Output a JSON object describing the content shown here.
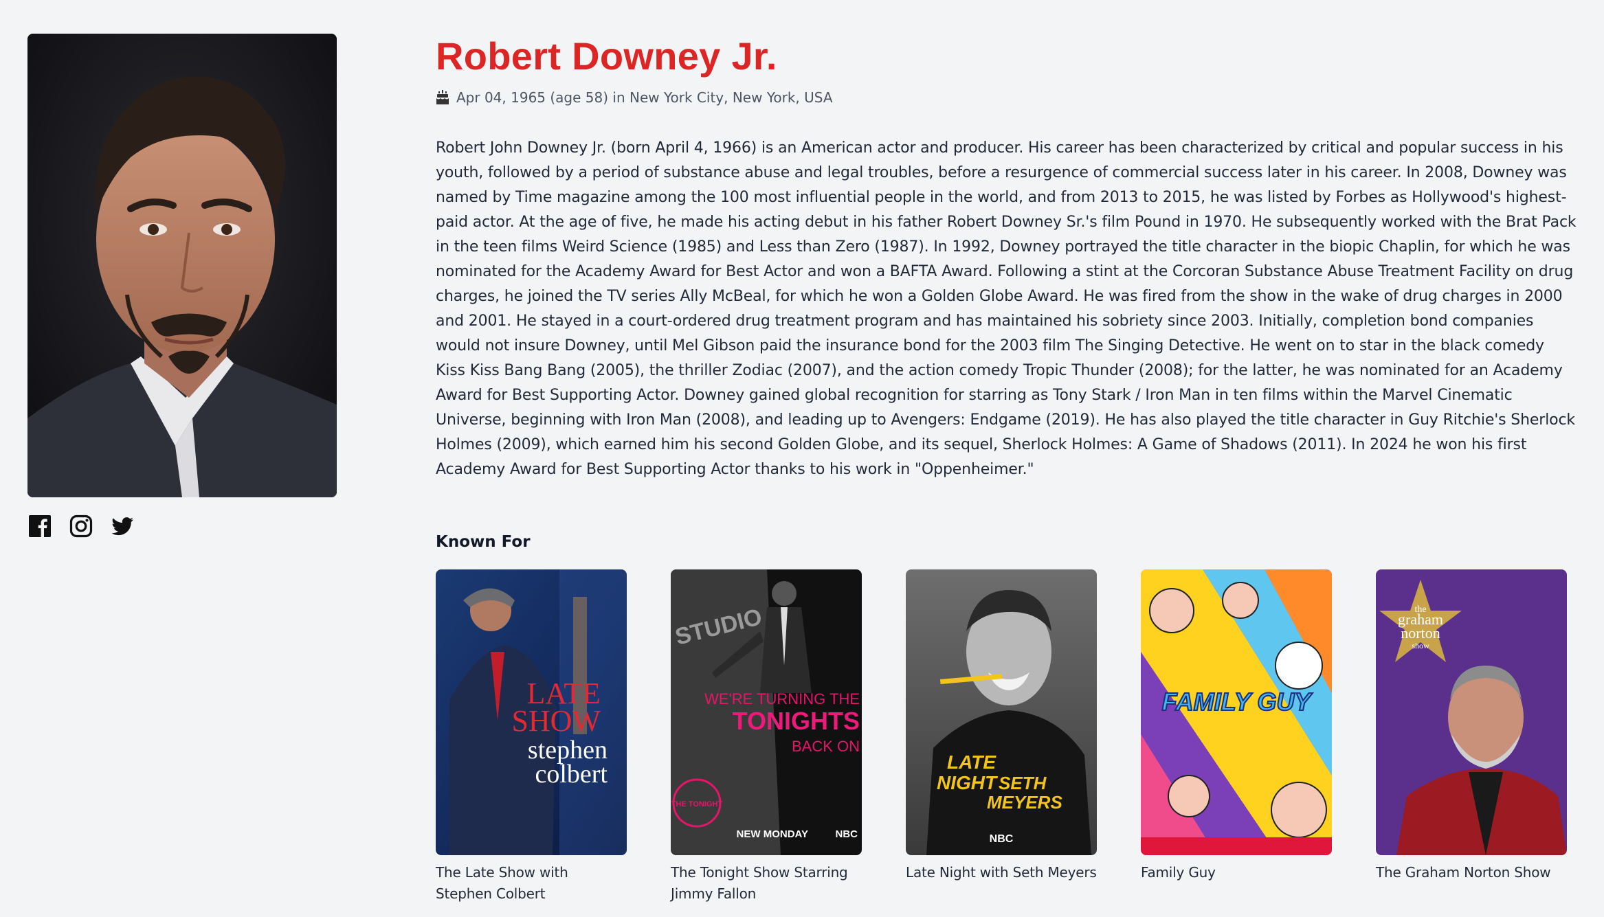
{
  "person": {
    "name": "Robert Downey Jr.",
    "birth_info": "Apr 04, 1965 (age 58) in New York City, New York, USA",
    "biography": "Robert John Downey Jr. (born April 4, 1966) is an American actor and producer. His career has been characterized by critical and popular success in his youth, followed by a period of substance abuse and legal troubles, before a resurgence of commercial success later in his career. In 2008, Downey was named by Time magazine among the 100 most influential people in the world, and from 2013 to 2015, he was listed by Forbes as Hollywood's highest-paid actor. At the age of five, he made his acting debut in his father Robert Downey Sr.'s film Pound in 1970. He subsequently worked with the Brat Pack in the teen films Weird Science (1985) and Less than Zero (1987). In 1992, Downey portrayed the title character in the biopic Chaplin, for which he was nominated for the Academy Award for Best Actor and won a BAFTA Award. Following a stint at the Corcoran Substance Abuse Treatment Facility on drug charges, he joined the TV series Ally McBeal, for which he won a Golden Globe Award. He was fired from the show in the wake of drug charges in 2000 and 2001. He stayed in a court-ordered drug treatment program and has maintained his sobriety since 2003. Initially, completion bond companies would not insure Downey, until Mel Gibson paid the insurance bond for the 2003 film The Singing Detective. He went on to star in the black comedy Kiss Kiss Bang Bang (2005), the thriller Zodiac (2007), and the action comedy Tropic Thunder (2008); for the latter, he was nominated for an Academy Award for Best Supporting Actor. Downey gained global recognition for starring as Tony Stark / Iron Man in ten films within the Marvel Cinematic Universe, beginning with Iron Man (2008), and leading up to Avengers: Endgame (2019). He has also played the title character in Guy Ritchie's Sherlock Holmes (2009), which earned him his second Golden Globe, and its sequel, Sherlock Holmes: A Game of Shadows (2011). In 2024 he won his first Academy Award for Best Supporting Actor thanks to his work in \"Oppenheimer.\""
  },
  "socials": [
    {
      "icon": "facebook-icon"
    },
    {
      "icon": "instagram-icon"
    },
    {
      "icon": "twitter-icon"
    }
  ],
  "known_for": {
    "heading": "Known For",
    "items": [
      {
        "title": "The Late Show with Stephen Colbert",
        "poster_text": [
          "LATE",
          "SHOW",
          "stephen",
          "colbert"
        ]
      },
      {
        "title": "The Tonight Show Starring Jimmy Fallon",
        "poster_text": [
          "STUDIO",
          "WE'RE TURNING THE",
          "TONIGHTS",
          "BACK ON",
          "NEW MONDAY",
          "NBC"
        ]
      },
      {
        "title": "Late Night with Seth Meyers",
        "poster_text": [
          "LATE",
          "NIGHT",
          "SETH",
          "MEYERS",
          "NBC"
        ]
      },
      {
        "title": "Family Guy",
        "poster_text": [
          "FAMILY GUY"
        ]
      },
      {
        "title": "The Graham Norton Show",
        "poster_text": [
          "the",
          "graham",
          "norton",
          "show"
        ]
      }
    ]
  },
  "colors": {
    "accent": "#dc2626",
    "background": "#f3f4f6",
    "text": "#1f2937"
  }
}
